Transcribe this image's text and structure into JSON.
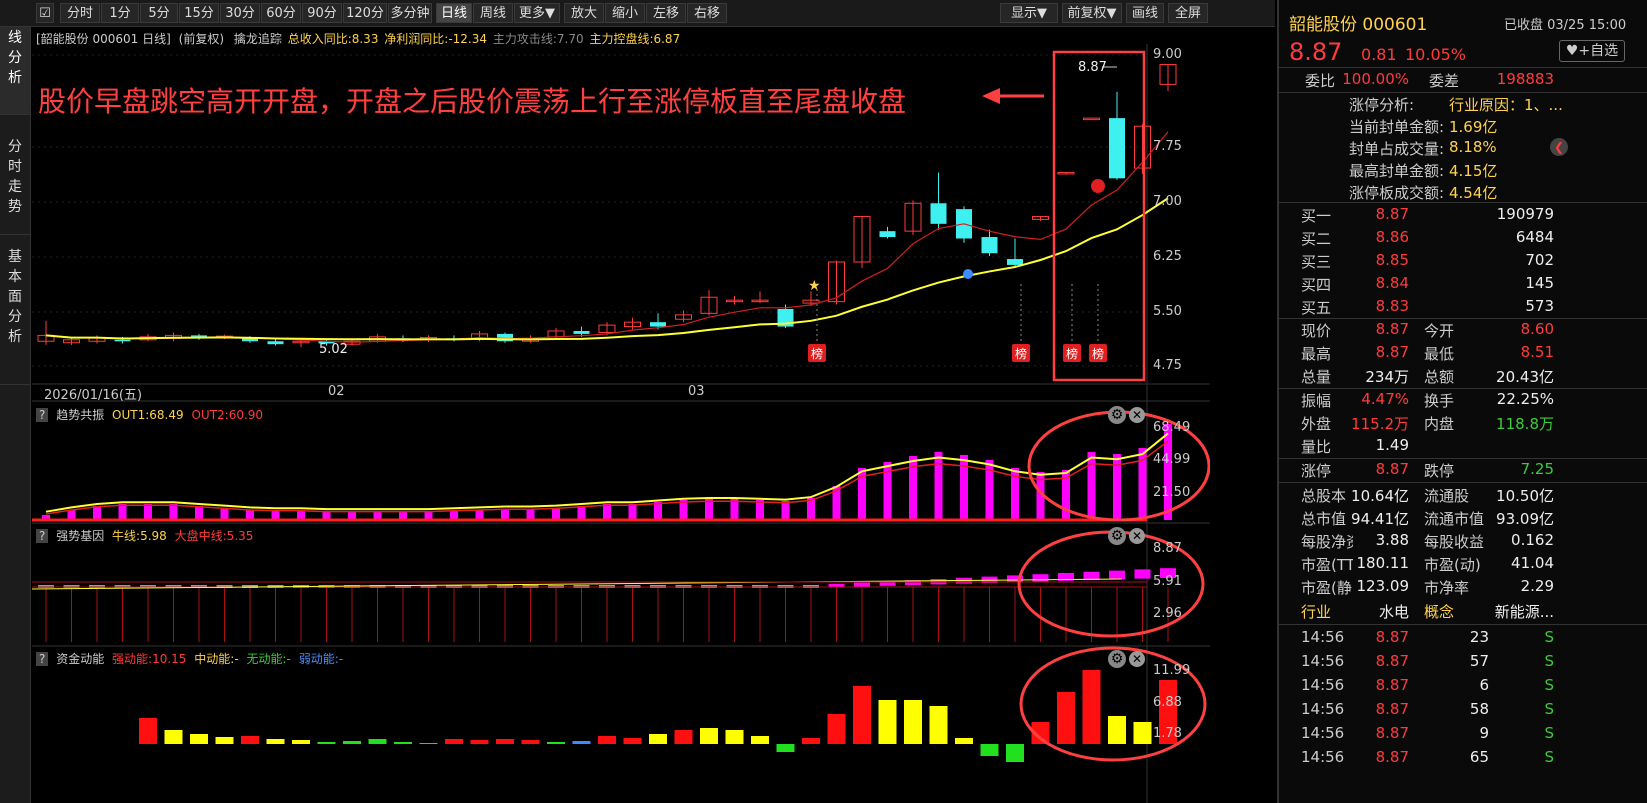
{
  "toolbar": {
    "left_buttons": [
      "分时",
      "1分",
      "5分",
      "15分",
      "30分",
      "60分",
      "90分",
      "120分",
      "多分钟",
      "日线",
      "周线",
      "更多▼",
      "放大",
      "缩小",
      "左移",
      "右移"
    ],
    "active": "日线",
    "right_buttons": [
      "显示▼",
      "前复权▼",
      "画线",
      "全屏"
    ]
  },
  "left_tabs": [
    "K\n线\n分\n析",
    "分\n时\n走\n势",
    "基\n本\n面\n分\n析"
  ],
  "main_info": {
    "stock": "[韶能股份 000601 日线]",
    "adjust": "(前复权)",
    "indicator": "擒龙追踪",
    "rev": "总收入同比:8.33",
    "profit": "净利润同比:-12.34",
    "attack": "主力攻击线:7.70",
    "control": "主力控盘线:6.87"
  },
  "annotation": "股价早盘跳空高开开盘，开盘之后股价震荡上行至涨停板直至尾盘收盘",
  "price_axis": [
    "9.00",
    "7.75",
    "7.00",
    "6.25",
    "5.50",
    "4.75"
  ],
  "date_axis": [
    "2026/01/16(五)",
    "02",
    "03"
  ],
  "price_labels": {
    "high": "8.87",
    "low": "5.02"
  },
  "badge": "榜",
  "panel1": {
    "title": "趋势共振",
    "out1": "OUT1:68.49",
    "out2": "OUT2:60.90",
    "axis": [
      "68.49",
      "44.99",
      "21.50"
    ]
  },
  "panel2": {
    "title": "强势基因",
    "bull": "牛线:5.98",
    "market": "大盘中线:5.35",
    "axis": [
      "8.87",
      "5.91",
      "2.96"
    ]
  },
  "panel3": {
    "title": "资金动能",
    "strong": "强动能:10.15",
    "mid": "中动能:-",
    "none": "无动能:-",
    "weak": "弱动能:-",
    "axis": [
      "11.99",
      "6.88",
      "1.78"
    ]
  },
  "right_panel": {
    "name": "韶能股份 000601",
    "status": "已收盘 03/25 15:00",
    "price": "8.87",
    "change": "0.81",
    "pct": "10.05%",
    "fav": "+自选",
    "weibi_l": "委比",
    "weibi_v": "100.00%",
    "weicha_l": "委差",
    "weicha_v": "198883",
    "limit_info": [
      {
        "l": "涨停分析:",
        "v": "行业原因：1、..."
      },
      {
        "l": "当前封单金额:",
        "v": "1.69亿"
      },
      {
        "l": "封单占成交量:",
        "v": "8.18%"
      },
      {
        "l": "最高封单金额:",
        "v": "4.15亿"
      },
      {
        "l": "涨停板成交额:",
        "v": "4.54亿"
      }
    ],
    "bids": [
      {
        "l": "买一",
        "p": "8.87",
        "v": "190979"
      },
      {
        "l": "买二",
        "p": "8.86",
        "v": "6484"
      },
      {
        "l": "买三",
        "p": "8.85",
        "v": "702"
      },
      {
        "l": "买四",
        "p": "8.84",
        "v": "145"
      },
      {
        "l": "买五",
        "p": "8.83",
        "v": "573"
      }
    ],
    "quote1": [
      {
        "l1": "现价",
        "v1": "8.87",
        "c1": "red",
        "l2": "今开",
        "v2": "8.60",
        "c2": "red"
      },
      {
        "l1": "最高",
        "v1": "8.87",
        "c1": "red",
        "l2": "最低",
        "v2": "8.51",
        "c2": "red"
      },
      {
        "l1": "总量",
        "v1": "234万",
        "c1": "white",
        "l2": "总额",
        "v2": "20.43亿",
        "c2": "white"
      }
    ],
    "quote2": [
      {
        "l1": "振幅",
        "v1": "4.47%",
        "c1": "red",
        "l2": "换手",
        "v2": "22.25%",
        "c2": "white"
      },
      {
        "l1": "外盘",
        "v1": "115.2万",
        "c1": "red",
        "l2": "内盘",
        "v2": "118.8万",
        "c2": "green"
      },
      {
        "l1": "量比",
        "v1": "1.49",
        "c1": "white",
        "l2": "",
        "v2": "",
        "c2": "white"
      }
    ],
    "quote3": [
      {
        "l1": "涨停",
        "v1": "8.87",
        "c1": "red",
        "l2": "跌停",
        "v2": "7.25",
        "c2": "green"
      }
    ],
    "fund": [
      {
        "l1": "总股本",
        "v1": "10.64亿",
        "l2": "流通股",
        "v2": "10.50亿"
      },
      {
        "l1": "总市值",
        "v1": "94.41亿",
        "l2": "流通市值",
        "v2": "93.09亿"
      },
      {
        "l1": "每股净资",
        "v1": "3.88",
        "l2": "每股收益",
        "v2": "0.162"
      },
      {
        "l1": "市盈(TTM",
        "v1": "180.11",
        "l2": "市盈(动)",
        "v2": "41.04"
      },
      {
        "l1": "市盈(静)",
        "v1": "123.09",
        "l2": "市净率",
        "v2": "2.29"
      }
    ],
    "sector": {
      "l1": "行业",
      "v1": "水电",
      "l2": "概念",
      "v2": "新能源..."
    },
    "ticks": [
      {
        "t": "14:56",
        "p": "8.87",
        "v": "23",
        "s": "S"
      },
      {
        "t": "14:56",
        "p": "8.87",
        "v": "57",
        "s": "S"
      },
      {
        "t": "14:56",
        "p": "8.87",
        "v": "6",
        "s": "S"
      },
      {
        "t": "14:56",
        "p": "8.87",
        "v": "58",
        "s": "S"
      },
      {
        "t": "14:56",
        "p": "8.87",
        "v": "9",
        "s": "S"
      },
      {
        "t": "14:56",
        "p": "8.87",
        "v": "65",
        "s": "S"
      }
    ]
  },
  "candles": [
    [
      5.1,
      5.18,
      5.05,
      5.38
    ],
    [
      5.08,
      5.12,
      5.05,
      5.16
    ],
    [
      5.1,
      5.15,
      5.07,
      5.18
    ],
    [
      5.12,
      5.1,
      5.07,
      5.16
    ],
    [
      5.12,
      5.16,
      5.1,
      5.2
    ],
    [
      5.14,
      5.18,
      5.1,
      5.22
    ],
    [
      5.18,
      5.16,
      5.12,
      5.2
    ],
    [
      5.16,
      5.17,
      5.13,
      5.19
    ],
    [
      5.14,
      5.1,
      5.08,
      5.17
    ],
    [
      5.1,
      5.06,
      5.04,
      5.13
    ],
    [
      5.08,
      5.1,
      5.02,
      5.14
    ],
    [
      5.1,
      5.07,
      5.04,
      5.13
    ],
    [
      5.06,
      5.1,
      5.04,
      5.14
    ],
    [
      5.1,
      5.16,
      5.08,
      5.2
    ],
    [
      5.14,
      5.12,
      5.09,
      5.18
    ],
    [
      5.12,
      5.15,
      5.09,
      5.18
    ],
    [
      5.14,
      5.12,
      5.1,
      5.18
    ],
    [
      5.14,
      5.2,
      5.1,
      5.24
    ],
    [
      5.2,
      5.1,
      5.08,
      5.22
    ],
    [
      5.1,
      5.14,
      5.08,
      5.18
    ],
    [
      5.16,
      5.24,
      5.12,
      5.28
    ],
    [
      5.24,
      5.2,
      5.16,
      5.3
    ],
    [
      5.22,
      5.32,
      5.18,
      5.36
    ],
    [
      5.3,
      5.36,
      5.26,
      5.42
    ],
    [
      5.36,
      5.3,
      5.26,
      5.48
    ],
    [
      5.4,
      5.46,
      5.36,
      5.52
    ],
    [
      5.48,
      5.7,
      5.45,
      5.8
    ],
    [
      5.64,
      5.66,
      5.6,
      5.72
    ],
    [
      5.66,
      5.66,
      5.62,
      5.78
    ],
    [
      5.54,
      5.3,
      5.28,
      5.6
    ],
    [
      5.62,
      5.66,
      5.58,
      5.78
    ],
    [
      5.64,
      6.18,
      5.6,
      6.2
    ],
    [
      6.18,
      6.8,
      6.1,
      6.8
    ],
    [
      6.6,
      6.52,
      6.5,
      6.66
    ],
    [
      6.6,
      6.98,
      6.55,
      7.02
    ],
    [
      6.98,
      6.7,
      6.62,
      7.4
    ],
    [
      6.9,
      6.5,
      6.44,
      6.94
    ],
    [
      6.52,
      6.3,
      6.26,
      6.62
    ],
    [
      6.22,
      6.14,
      6.1,
      6.5
    ],
    [
      6.76,
      6.8,
      6.74,
      6.8
    ],
    [
      7.38,
      7.4,
      7.38,
      7.4
    ],
    [
      8.14,
      8.14,
      8.14,
      8.14
    ],
    [
      8.14,
      7.32,
      7.3,
      8.5
    ],
    [
      7.46,
      8.03,
      7.38,
      8.06
    ],
    [
      8.6,
      8.87,
      8.51,
      8.87
    ]
  ]
}
